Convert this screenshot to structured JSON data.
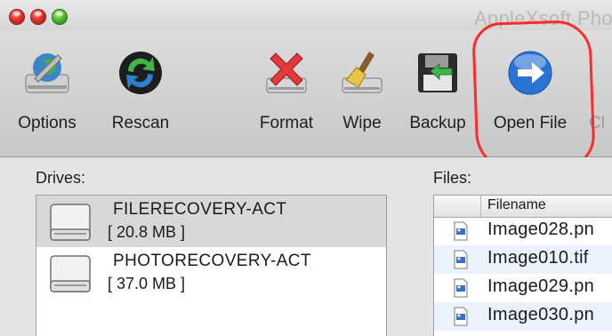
{
  "window": {
    "title": "AppleXsoft Pho"
  },
  "toolbar": {
    "buttons": [
      {
        "label": "Options",
        "icon": "options-globe-icon"
      },
      {
        "label": "Rescan",
        "icon": "rescan-icon"
      },
      {
        "label": "Format",
        "icon": "format-drive-icon"
      },
      {
        "label": "Wipe",
        "icon": "wipe-drive-icon"
      },
      {
        "label": "Backup",
        "icon": "backup-floppy-icon"
      },
      {
        "label": "Open File",
        "icon": "open-file-arrow-icon"
      },
      {
        "label": "Cl",
        "icon": "partial-icon"
      }
    ]
  },
  "drives": {
    "label": "Drives:",
    "items": [
      {
        "name": "FILERECOVERY-ACT",
        "size": "[ 20.8 MB ]",
        "selected": true
      },
      {
        "name": "PHOTORECOVERY-ACT",
        "size": "[ 37.0 MB ]",
        "selected": false
      }
    ]
  },
  "files": {
    "label": "Files:",
    "column_filename": "Filename",
    "rows": [
      {
        "name": "Image028.pn"
      },
      {
        "name": "Image010.tif"
      },
      {
        "name": "Image029.pn"
      },
      {
        "name": "Image030.pn"
      }
    ]
  },
  "colors": {
    "annotation": "#ff2a2a",
    "selected_row": "#d8d8d8",
    "alt_row": "#edf3fe"
  }
}
